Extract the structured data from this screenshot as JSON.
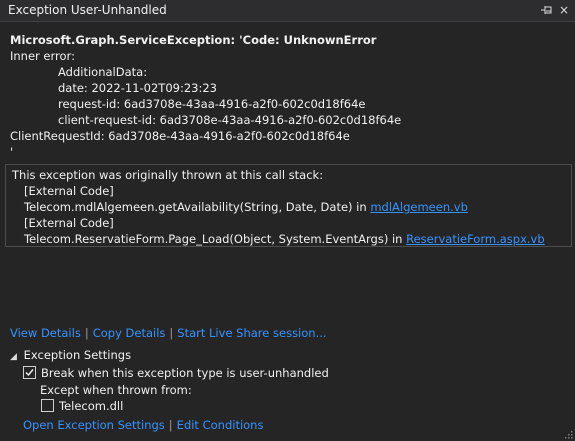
{
  "window": {
    "title": "Exception User-Unhandled",
    "pin_icon": "pin-icon",
    "close_icon": "close-icon",
    "close_glyph": "×"
  },
  "message": {
    "lines": [
      "Microsoft.Graph.ServiceException: 'Code: UnknownError",
      "Inner error:",
      "AdditionalData:",
      "date: 2022-11-02T09:23:23",
      "request-id: 6ad3708e-43aa-4916-a2f0-602c0d18f64e",
      "client-request-id: 6ad3708e-43aa-4916-a2f0-602c0d18f64e",
      "ClientRequestId: 6ad3708e-43aa-4916-a2f0-602c0d18f64e",
      "'"
    ]
  },
  "callstack": {
    "heading": "This exception was originally thrown at this call stack:",
    "frames": [
      {
        "text": "[External Code]",
        "link": ""
      },
      {
        "text": "Telecom.mdlAlgemeen.getAvailability(String, Date, Date) in ",
        "link": "mdlAlgemeen.vb"
      },
      {
        "text": "[External Code]",
        "link": ""
      },
      {
        "text": "Telecom.ReservatieForm.Page_Load(Object, System.EventArgs) in ",
        "link": "ReservatieForm.aspx.vb"
      }
    ]
  },
  "actions": {
    "view_details": "View Details",
    "copy_details": "Copy Details",
    "live_share": "Start Live Share session...",
    "separator": "|"
  },
  "settings": {
    "heading": "Exception Settings",
    "break_label": "Break when this exception type is user-unhandled",
    "break_checked": true,
    "except_label": "Except when thrown from:",
    "module_label": "Telecom.dll",
    "module_checked": false
  },
  "footer": {
    "open_settings": "Open Exception Settings",
    "edit_conditions": "Edit Conditions",
    "separator": "|"
  },
  "colors": {
    "background": "#252526",
    "link": "#3794ff",
    "text": "#f1f1f1"
  }
}
